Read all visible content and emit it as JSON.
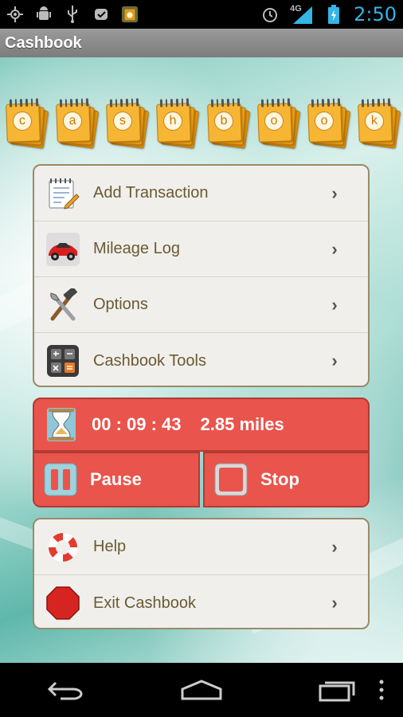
{
  "status_bar": {
    "time": "2:50",
    "network": "4G",
    "icons": [
      "gps-icon",
      "android-debug-icon",
      "usb-icon",
      "app-notification-icon",
      "cashbook-notification-icon",
      "alarm-icon",
      "signal-icon",
      "battery-charging-icon"
    ]
  },
  "app": {
    "title": "Cashbook"
  },
  "banner": {
    "letters": [
      "c",
      "a",
      "s",
      "h",
      "b",
      "o",
      "o",
      "k"
    ]
  },
  "menu": {
    "items": [
      {
        "label": "Add Transaction",
        "icon": "notepad-pencil-icon"
      },
      {
        "label": "Mileage Log",
        "icon": "red-car-icon"
      },
      {
        "label": "Options",
        "icon": "hammer-wrench-icon"
      },
      {
        "label": "Cashbook Tools",
        "icon": "calculator-icon"
      }
    ]
  },
  "tracker": {
    "elapsed": "00 : 09 : 43",
    "distance": "2.85 miles",
    "pause_label": "Pause",
    "stop_label": "Stop"
  },
  "secondary_menu": {
    "items": [
      {
        "label": "Help",
        "icon": "lifebuoy-icon"
      },
      {
        "label": "Exit Cashbook",
        "icon": "stop-sign-icon"
      }
    ]
  },
  "colors": {
    "accent_red": "#e9544c",
    "label_brown": "#6b5a32",
    "status_blue": "#33b5e5",
    "pad_orange": "#f4a81d"
  }
}
